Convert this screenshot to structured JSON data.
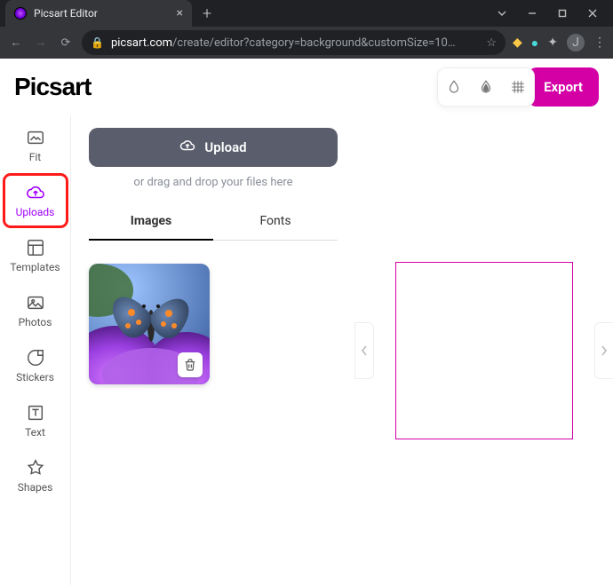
{
  "browser": {
    "tab_title": "Picsart Editor",
    "url_domain": "picsart.com",
    "url_path": "/create/editor?category=background&customSize=10…",
    "avatar_initial": "J"
  },
  "app": {
    "logo": "Picsart",
    "export_label": "Export",
    "rail": [
      {
        "key": "fit",
        "label": "Fit"
      },
      {
        "key": "uploads",
        "label": "Uploads",
        "active": true
      },
      {
        "key": "templates",
        "label": "Templates"
      },
      {
        "key": "photos",
        "label": "Photos"
      },
      {
        "key": "stickers",
        "label": "Stickers"
      },
      {
        "key": "text",
        "label": "Text"
      },
      {
        "key": "shapes",
        "label": "Shapes"
      }
    ],
    "panel": {
      "upload_label": "Upload",
      "drag_hint": "or drag and drop your files here",
      "tabs": [
        {
          "key": "images",
          "label": "Images",
          "active": true
        },
        {
          "key": "fonts",
          "label": "Fonts"
        }
      ],
      "thumbnails": [
        {
          "key": "butterfly",
          "alt": "butterfly on purple flowers"
        }
      ]
    }
  }
}
